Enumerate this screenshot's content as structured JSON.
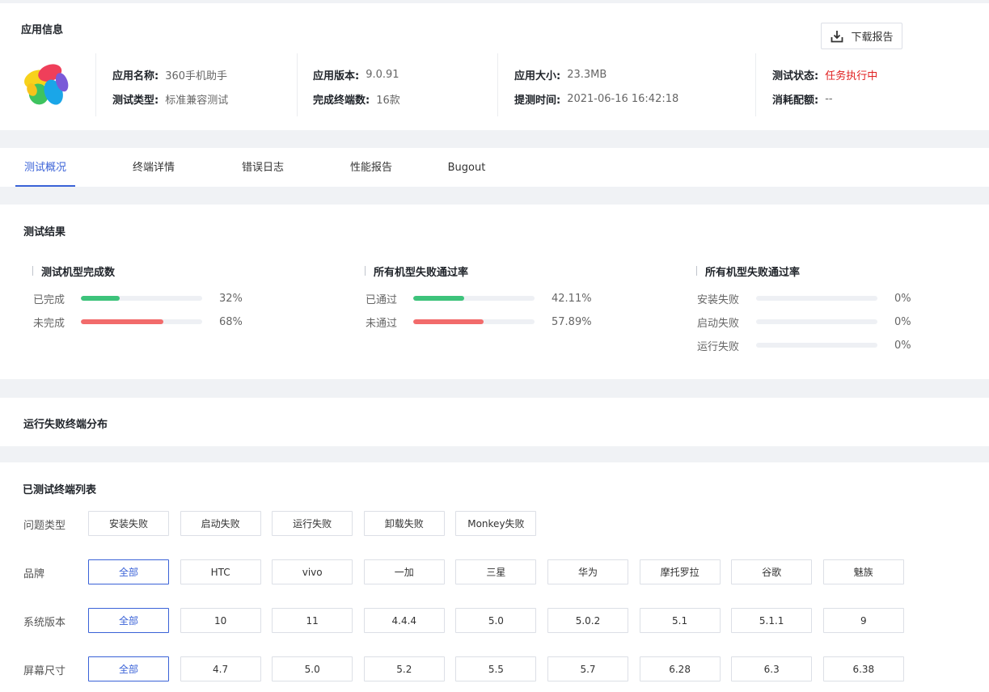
{
  "app_info": {
    "title": "应用信息",
    "download_label": "下载报告",
    "name_label": "应用名称:",
    "name_value": "360手机助手",
    "test_type_label": "测试类型:",
    "test_type_value": "标准兼容测试",
    "version_label": "应用版本:",
    "version_value": "9.0.91",
    "devices_done_label": "完成终端数:",
    "devices_done_value": "16款",
    "size_label": "应用大小:",
    "size_value": "23.3MB",
    "submit_time_label": "提测时间:",
    "submit_time_value": "2021-06-16 16:42:18",
    "status_label": "测试状态:",
    "status_value": "任务执行中",
    "quota_label": "消耗配额:",
    "quota_value": "--",
    "status_color": "#e02020"
  },
  "tabs": [
    {
      "label": "测试概况",
      "active": true
    },
    {
      "label": "终端详情",
      "active": false
    },
    {
      "label": "错误日志",
      "active": false
    },
    {
      "label": "性能报告",
      "active": false
    },
    {
      "label": "Bugout",
      "active": false
    }
  ],
  "test_results": {
    "title": "测试结果",
    "columns": [
      {
        "title": "测试机型完成数",
        "rows": [
          {
            "label": "已完成",
            "percent": 32,
            "value": "32%",
            "color": "#3dc37b"
          },
          {
            "label": "未完成",
            "percent": 68,
            "value": "68%",
            "color": "#f26b6b"
          }
        ]
      },
      {
        "title": "所有机型失败通过率",
        "rows": [
          {
            "label": "已通过",
            "percent": 42.11,
            "value": "42.11%",
            "color": "#3dc37b"
          },
          {
            "label": "未通过",
            "percent": 57.89,
            "value": "57.89%",
            "color": "#f26b6b"
          }
        ]
      },
      {
        "title": "所有机型失败通过率",
        "rows": [
          {
            "label": "安装失败",
            "percent": 0,
            "value": "0%",
            "color": "#3dc37b"
          },
          {
            "label": "启动失败",
            "percent": 0,
            "value": "0%",
            "color": "#3dc37b"
          },
          {
            "label": "运行失败",
            "percent": 0,
            "value": "0%",
            "color": "#3dc37b"
          }
        ]
      }
    ]
  },
  "fail_distribution": {
    "title": "运行失败终端分布"
  },
  "device_list": {
    "title": "已测试终端列表",
    "filters": [
      {
        "label": "问题类型",
        "options": [
          "安装失败",
          "启动失败",
          "运行失败",
          "卸载失败",
          "Monkey失败"
        ],
        "selected": -1
      },
      {
        "label": "品牌",
        "options": [
          "全部",
          "HTC",
          "vivo",
          "一加",
          "三星",
          "华为",
          "摩托罗拉",
          "谷歌",
          "魅族"
        ],
        "selected": 0
      },
      {
        "label": "系统版本",
        "options": [
          "全部",
          "10",
          "11",
          "4.4.4",
          "5.0",
          "5.0.2",
          "5.1",
          "5.1.1",
          "9"
        ],
        "selected": 0
      },
      {
        "label": "屏幕尺寸",
        "options": [
          "全部",
          "4.7",
          "5.0",
          "5.2",
          "5.5",
          "5.7",
          "6.28",
          "6.3",
          "6.38"
        ],
        "selected": 0
      }
    ]
  },
  "accent_color": "#3a62d7"
}
